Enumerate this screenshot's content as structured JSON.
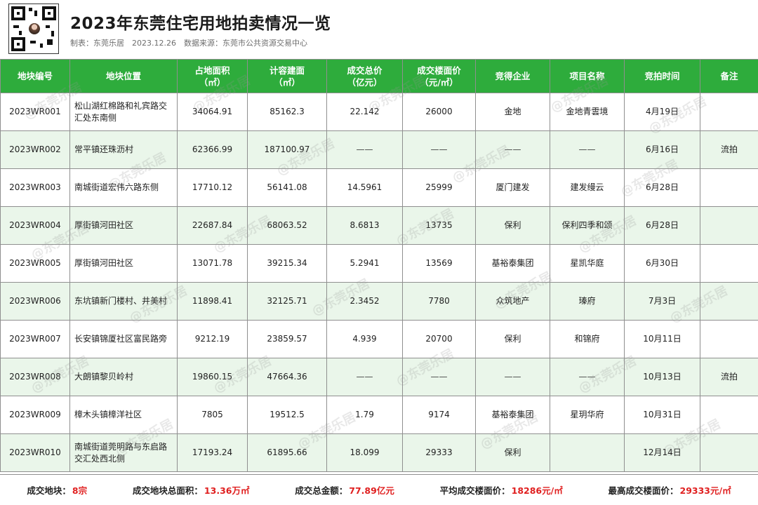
{
  "header": {
    "title": "2023年东莞住宅用地拍卖情况一览",
    "subtitle": "制表：东莞乐居　2023.12.26　数据来源：东莞市公共资源交易中心"
  },
  "columns": [
    "地块编号",
    "地块位置",
    "占地面积\n（㎡）",
    "计容建面\n（㎡）",
    "成交总价\n（亿元）",
    "成交楼面价\n（元/㎡）",
    "竞得企业",
    "项目名称",
    "竞拍时间",
    "备注"
  ],
  "rows": [
    [
      "2023WR001",
      "松山湖红棉路和礼宾路交汇处东南侧",
      "34064.91",
      "85162.3",
      "22.142",
      "26000",
      "金地",
      "金地青雲境",
      "4月19日",
      ""
    ],
    [
      "2023WR002",
      "常平镇还珠沥村",
      "62366.99",
      "187100.97",
      "——",
      "——",
      "——",
      "——",
      "6月16日",
      "流拍"
    ],
    [
      "2023WR003",
      "南城街道宏伟六路东侧",
      "17710.12",
      "56141.08",
      "14.5961",
      "25999",
      "厦门建发",
      "建发缦云",
      "6月28日",
      ""
    ],
    [
      "2023WR004",
      "厚街镇河田社区",
      "22687.84",
      "68063.52",
      "8.6813",
      "13735",
      "保利",
      "保利四季和颂",
      "6月28日",
      ""
    ],
    [
      "2023WR005",
      "厚街镇河田社区",
      "13071.78",
      "39215.34",
      "5.2941",
      "13569",
      "基裕泰集团",
      "星凯华庭",
      "6月30日",
      ""
    ],
    [
      "2023WR006",
      "东坑镇新门楼村、井美村",
      "11898.41",
      "32125.71",
      "2.3452",
      "7780",
      "众筑地产",
      "瑧府",
      "7月3日",
      ""
    ],
    [
      "2023WR007",
      "长安镇锦厦社区富民路旁",
      "9212.19",
      "23859.57",
      "4.939",
      "20700",
      "保利",
      "和锦府",
      "10月11日",
      ""
    ],
    [
      "2023WR008",
      "大朗镇黎贝岭村",
      "19860.15",
      "47664.36",
      "——",
      "——",
      "——",
      "——",
      "10月13日",
      "流拍"
    ],
    [
      "2023WR009",
      "樟木头镇樟洋社区",
      "7805",
      "19512.5",
      "1.79",
      "9174",
      "基裕泰集团",
      "星玥华府",
      "10月31日",
      ""
    ],
    [
      "2023WR010",
      "南城街道莞明路与东启路交汇处西北侧",
      "17193.24",
      "61895.66",
      "18.099",
      "29333",
      "保利",
      "",
      "12月14日",
      ""
    ]
  ],
  "footer": [
    {
      "label": "成交地块：",
      "value": "8宗"
    },
    {
      "label": "成交地块总面积：",
      "value": "13.36万㎡"
    },
    {
      "label": "成交总金额：",
      "value": "77.89亿元"
    },
    {
      "label": "平均成交楼面价：",
      "value": "18286元/㎡"
    },
    {
      "label": "最高成交楼面价：",
      "value": "29333元/㎡"
    }
  ],
  "watermark": "@东莞乐居",
  "colors": {
    "header_green": "#2eac3c",
    "stripe_green": "#eaf6ea",
    "value_red": "#e02020"
  }
}
